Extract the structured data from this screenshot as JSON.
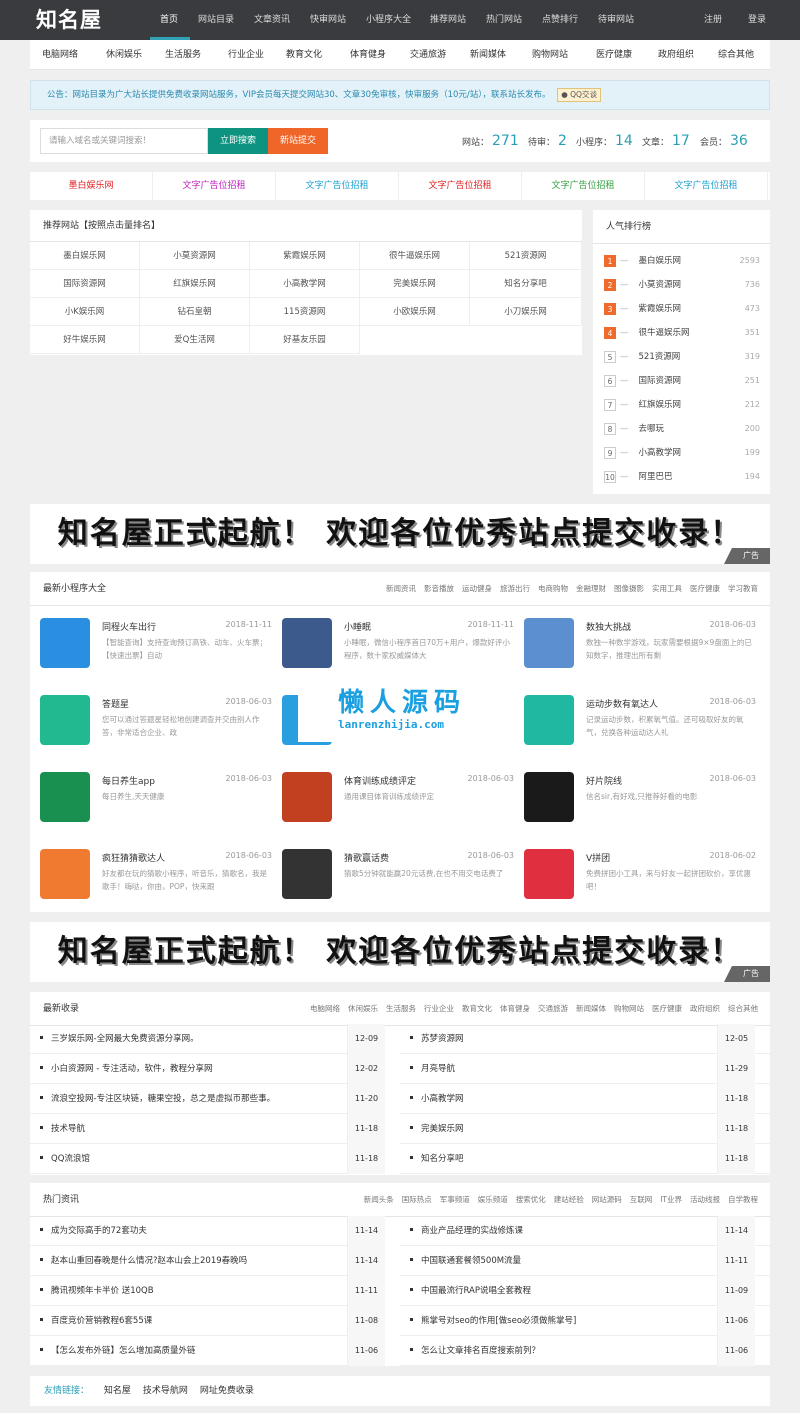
{
  "header": {
    "logo": "知名屋",
    "nav": [
      "首页",
      "网站目录",
      "文章资讯",
      "快审网站",
      "小程序大全",
      "推荐网站",
      "热门网站",
      "点赞排行",
      "待审网站"
    ],
    "register": "注册",
    "login": "登录"
  },
  "categories": [
    "电脑网络",
    "休闲娱乐",
    "生活服务",
    "行业企业",
    "教育文化",
    "体育健身",
    "交通旅游",
    "新闻媒体",
    "购物网站",
    "医疗健康",
    "政府组织",
    "综合其他"
  ],
  "notice": {
    "text": "公告：网站目录为广大站长提供免费收录网站服务，VIP会员每天提交网站30、文章30免审核，快审服务（10元/站），联系站长发布。",
    "qq": "QQ交谈"
  },
  "search": {
    "placeholder": "请输入域名或关键词搜索！",
    "search_btn": "立即搜索",
    "submit_btn": "新站提交"
  },
  "stats": [
    {
      "label": "网站：",
      "value": "271"
    },
    {
      "label": "待审：",
      "value": "2"
    },
    {
      "label": "小程序：",
      "value": "14"
    },
    {
      "label": "文章：",
      "value": "17"
    },
    {
      "label": "会员：",
      "value": "36"
    }
  ],
  "ads": [
    {
      "text": "墨白娱乐网",
      "color": "#e02020"
    },
    {
      "text": "文字广告位招租",
      "color": "#c020c0"
    },
    {
      "text": "文字广告位招租",
      "color": "#1a9fd0"
    },
    {
      "text": "文字广告位招租",
      "color": "#e02020"
    },
    {
      "text": "文字广告位招租",
      "color": "#30a040"
    },
    {
      "text": "文字广告位招租",
      "color": "#1a9fd0"
    }
  ],
  "recommended": {
    "title": "推荐网站【按照点击量排名】",
    "sites": [
      "墨白娱乐网",
      "小莫资源网",
      "紫霞娱乐网",
      "很牛逼娱乐网",
      "521资源网",
      "国际资源网",
      "红旗娱乐网",
      "小高教学网",
      "完美娱乐网",
      "知名分享吧",
      "小K娱乐网",
      "钻石皇朝",
      "115资源网",
      "小欧娱乐网",
      "小刀娱乐网",
      "好牛娱乐网",
      "爱Q生活网",
      "好基友乐园"
    ]
  },
  "ranking": {
    "title": "人气排行榜",
    "items": [
      {
        "rank": "1",
        "name": "墨白娱乐网",
        "count": "2593"
      },
      {
        "rank": "2",
        "name": "小莫资源网",
        "count": "736"
      },
      {
        "rank": "3",
        "name": "紫霞娱乐网",
        "count": "473"
      },
      {
        "rank": "4",
        "name": "很牛逼娱乐网",
        "count": "351"
      },
      {
        "rank": "5",
        "name": "521资源网",
        "count": "319"
      },
      {
        "rank": "6",
        "name": "国际资源网",
        "count": "251"
      },
      {
        "rank": "7",
        "name": "红旗娱乐网",
        "count": "212"
      },
      {
        "rank": "8",
        "name": "去哪玩",
        "count": "200"
      },
      {
        "rank": "9",
        "name": "小高教学网",
        "count": "199"
      },
      {
        "rank": "10",
        "name": "阿里巴巴",
        "count": "194"
      }
    ]
  },
  "banner": {
    "text": "知名屋正式起航！ 欢迎各位优秀站点提交收录！",
    "tag": "广告"
  },
  "miniapps": {
    "title": "最新小程序大全",
    "tabs": [
      "新闻资讯",
      "影音播放",
      "运动健身",
      "旅游出行",
      "电商购物",
      "金融理财",
      "图像摄影",
      "实用工具",
      "医疗健康",
      "学习教育"
    ],
    "items": [
      {
        "name": "同程火车出行",
        "date": "2018-11-11",
        "desc": "【智能查询】支持查询预订高铁、动车、火车票；【快速出票】自动",
        "icon": "train-icon",
        "color": "#2a8fe0"
      },
      {
        "name": "小睡眠",
        "date": "2018-11-11",
        "desc": "小睡眠，微信小程序首日70万+用户，爆款好评小程序，数十家权威媒体大",
        "icon": "cat-icon",
        "color": "#3d5a8c"
      },
      {
        "name": "数独大挑战",
        "date": "2018-06-03",
        "desc": "数独一种数学游戏，玩家需要根据9×9盘面上的已知数字，推理出所有剩",
        "icon": "sudoku-icon",
        "color": "#5b8fd0"
      },
      {
        "name": "答题星",
        "date": "2018-06-03",
        "desc": "您可以通过答题星轻松地创建调查并交由别人作答，非常适合企业、政",
        "icon": "quiz-icon",
        "color": "#22b890"
      },
      {
        "name": "",
        "date": "",
        "desc": "",
        "icon": "blue-icon",
        "color": "#2a9fe0"
      },
      {
        "name": "运动步数有氧达人",
        "date": "2018-06-03",
        "desc": "记录运动步数，积累氧气值。还可吸取好友的氧气，兑换各种运动达人礼",
        "icon": "runner-icon",
        "color": "#20b8a0"
      },
      {
        "name": "每日养生app",
        "date": "2018-06-03",
        "desc": "每日养生,天天健康",
        "icon": "health-icon",
        "color": "#1a9050"
      },
      {
        "name": "体育训练成绩评定",
        "date": "2018-06-03",
        "desc": "通用课目体育训练成绩评定",
        "icon": "muscle-icon",
        "color": "#c04020"
      },
      {
        "name": "好片院线",
        "date": "2018-06-03",
        "desc": "信名sir,有好戏,只推荐好看的电影",
        "icon": "film-icon",
        "color": "#1a1a1a"
      },
      {
        "name": "疯狂猜猜歌达人",
        "date": "2018-06-03",
        "desc": "好友都在玩的猜歌小程序，听音乐，猜歌名，我是歌手！嗨哒，你由，POP，快来跟",
        "icon": "headphone-icon",
        "color": "#f07a30"
      },
      {
        "name": "猜歌赢话费",
        "date": "2018-06-03",
        "desc": "猜歌5分钟就能赢20元话费,在也不用交电话费了",
        "icon": "qrcode-icon",
        "color": "#333333"
      },
      {
        "name": "V拼团",
        "date": "2018-06-02",
        "desc": "免费拼团小工具，来与好友一起拼团砍价，享优惠吧！",
        "icon": "pin-icon",
        "color": "#e03040"
      }
    ]
  },
  "watermark": {
    "line1": "懒人源码",
    "line2": "lanrenzhijia.com"
  },
  "latest": {
    "title": "最新收录",
    "tabs": [
      "电脑网络",
      "休闲娱乐",
      "生活服务",
      "行业企业",
      "教育文化",
      "体育健身",
      "交通旅游",
      "新闻媒体",
      "购物网站",
      "医疗健康",
      "政府组织",
      "综合其他"
    ],
    "rows": [
      {
        "left": "三岁娱乐网-全网最大免费资源分享网。",
        "ldate": "12-09",
        "right": "苏梦资源网",
        "rdate": "12-05"
      },
      {
        "left": "小白资源网 - 专注活动，软件，教程分享网",
        "ldate": "12-02",
        "right": "月亮导航",
        "rdate": "11-29"
      },
      {
        "left": "流浪空投网-专注区块链，糖果空投，总之是虚拟币那些事。",
        "ldate": "11-20",
        "right": "小高教学网",
        "rdate": "11-18"
      },
      {
        "left": "技术导航",
        "ldate": "11-18",
        "right": "完美娱乐网",
        "rdate": "11-18"
      },
      {
        "left": "QQ流浪馆",
        "ldate": "11-18",
        "right": "知名分享吧",
        "rdate": "11-18"
      }
    ]
  },
  "hotnews": {
    "title": "热门资讯",
    "tabs": [
      "新闻头条",
      "国际热点",
      "军事频道",
      "娱乐频道",
      "搜索优化",
      "建站经验",
      "网站源码",
      "互联网",
      "IT业界",
      "活动线报",
      "自学教程"
    ],
    "rows": [
      {
        "left": "成为交际高手的72套功夫",
        "ldate": "11-14",
        "right": "商业产品经理的实战修炼课",
        "rdate": "11-14"
      },
      {
        "left": "赵本山重回春晚是什么情况?赵本山会上2019春晚吗",
        "ldate": "11-14",
        "right": "中国联通套餐领500M流量",
        "rdate": "11-11"
      },
      {
        "left": "腾讯视频年卡半价 送10QB",
        "ldate": "11-11",
        "right": "中国最流行RAP说唱全套教程",
        "rdate": "11-09"
      },
      {
        "left": "百度竞价营销教程6套55课",
        "ldate": "11-08",
        "right": "熊掌号对seo的作用[做seo必须做熊掌号]",
        "rdate": "11-06"
      },
      {
        "left": "【怎么发布外链】怎么增加高质量外链",
        "ldate": "11-06",
        "right": "怎么让文章排名百度搜索前列？",
        "rdate": "11-06"
      }
    ]
  },
  "friends": {
    "label": "友情链接：",
    "links": [
      "知名屋",
      "技术导航网",
      "网址免费收录"
    ]
  }
}
